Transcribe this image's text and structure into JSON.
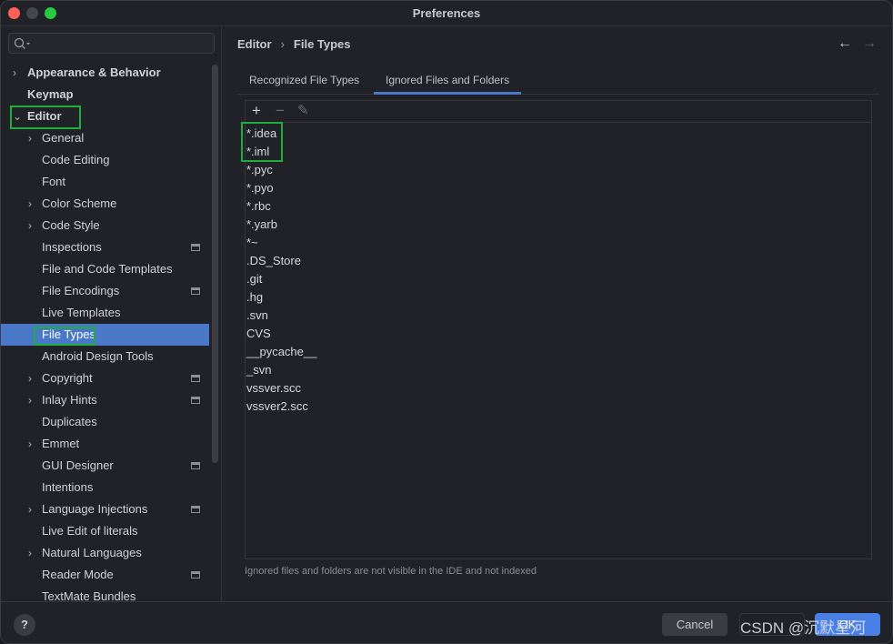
{
  "window": {
    "title": "Preferences"
  },
  "search": {
    "placeholder": ""
  },
  "sidebar": {
    "items": [
      {
        "label": "Appearance & Behavior",
        "level": 0,
        "chevron": "right"
      },
      {
        "label": "Keymap",
        "level": 0,
        "chevron": ""
      },
      {
        "label": "Editor",
        "level": 0,
        "chevron": "down",
        "highlighted": true
      },
      {
        "label": "General",
        "level": 1,
        "chevron": "right"
      },
      {
        "label": "Code Editing",
        "level": 1,
        "chevron": ""
      },
      {
        "label": "Font",
        "level": 1,
        "chevron": ""
      },
      {
        "label": "Color Scheme",
        "level": 1,
        "chevron": "right"
      },
      {
        "label": "Code Style",
        "level": 1,
        "chevron": "right"
      },
      {
        "label": "Inspections",
        "level": 1,
        "chevron": "",
        "settings_icon": true
      },
      {
        "label": "File and Code Templates",
        "level": 1,
        "chevron": ""
      },
      {
        "label": "File Encodings",
        "level": 1,
        "chevron": "",
        "settings_icon": true
      },
      {
        "label": "Live Templates",
        "level": 1,
        "chevron": ""
      },
      {
        "label": "File Types",
        "level": 1,
        "chevron": "",
        "selected": true,
        "highlighted": true
      },
      {
        "label": "Android Design Tools",
        "level": 1,
        "chevron": ""
      },
      {
        "label": "Copyright",
        "level": 1,
        "chevron": "right",
        "settings_icon": true
      },
      {
        "label": "Inlay Hints",
        "level": 1,
        "chevron": "right",
        "settings_icon": true
      },
      {
        "label": "Duplicates",
        "level": 1,
        "chevron": ""
      },
      {
        "label": "Emmet",
        "level": 1,
        "chevron": "right"
      },
      {
        "label": "GUI Designer",
        "level": 1,
        "chevron": "",
        "settings_icon": true
      },
      {
        "label": "Intentions",
        "level": 1,
        "chevron": ""
      },
      {
        "label": "Language Injections",
        "level": 1,
        "chevron": "right",
        "settings_icon": true
      },
      {
        "label": "Live Edit of literals",
        "level": 1,
        "chevron": ""
      },
      {
        "label": "Natural Languages",
        "level": 1,
        "chevron": "right"
      },
      {
        "label": "Reader Mode",
        "level": 1,
        "chevron": "",
        "settings_icon": true
      },
      {
        "label": "TextMate Bundles",
        "level": 1,
        "chevron": ""
      }
    ]
  },
  "breadcrumb": {
    "parent": "Editor",
    "separator": "›",
    "current": "File Types"
  },
  "tabs": [
    {
      "label": "Recognized File Types",
      "active": false
    },
    {
      "label": "Ignored Files and Folders",
      "active": true
    }
  ],
  "toolbar": {
    "add": "+",
    "remove": "−",
    "edit": "✎"
  },
  "ignored": [
    "*.idea",
    "*.iml",
    "*.pyc",
    "*.pyo",
    "*.rbc",
    "*.yarb",
    "*~",
    ".DS_Store",
    ".git",
    ".hg",
    ".svn",
    "CVS",
    "__pycache__",
    "_svn",
    "vssver.scc",
    "vssver2.scc"
  ],
  "note": "Ignored files and folders are not visible in the IDE and not indexed",
  "footer": {
    "help": "?",
    "cancel": "Cancel",
    "ok": "OK"
  },
  "watermark": "CSDN @沉默星河",
  "colors": {
    "accent": "#4a78c8",
    "highlight": "#1fae3c"
  }
}
